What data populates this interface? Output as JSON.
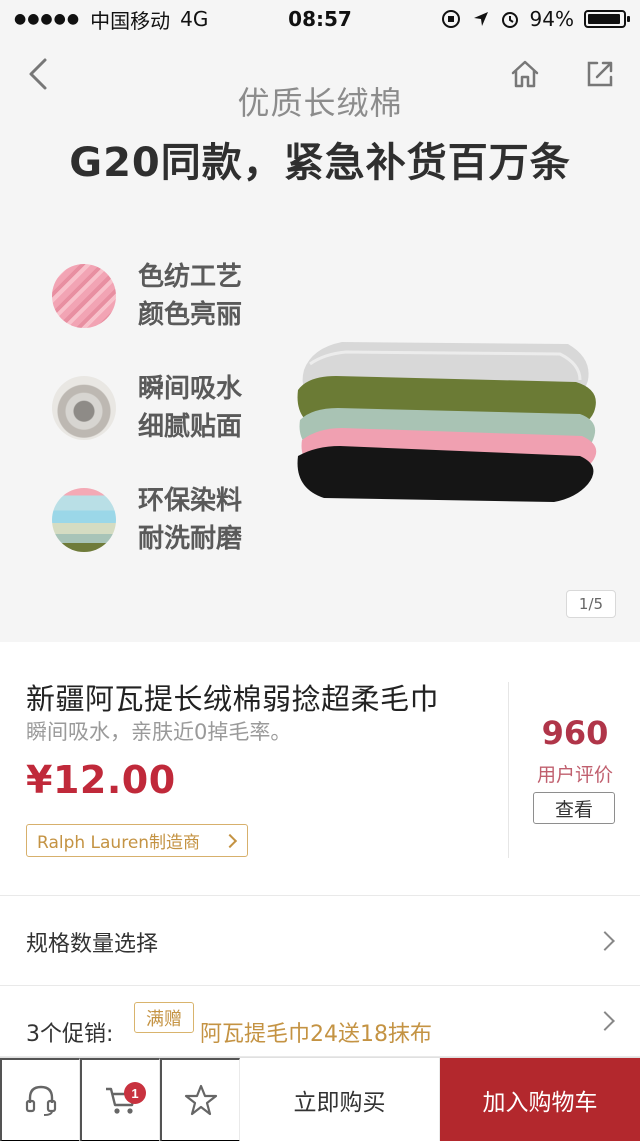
{
  "status_bar": {
    "signal": "●●●●●",
    "carrier": "中国移动",
    "network": "4G",
    "time": "08:57",
    "battery_percent": "94%",
    "battery_level": 0.94
  },
  "nav": {
    "back_icon": "chevron-left-icon",
    "home_icon": "home-icon",
    "share_icon": "share-icon"
  },
  "hero": {
    "subtitle": "优质长绒棉",
    "title": "G20同款，紧急补货百万条",
    "features": [
      {
        "line1": "色纺工艺",
        "line2": "颜色亮丽"
      },
      {
        "line1": "瞬间吸水",
        "line2": "细腻贴面"
      },
      {
        "line1": "环保染料",
        "line2": "耐洗耐磨"
      }
    ],
    "page_indicator": "1/5"
  },
  "product": {
    "title": "新疆阿瓦提长绒棉弱捻超柔毛巾",
    "subtitle": "瞬间吸水，亲肤近0掉毛率。",
    "price": "¥12.00",
    "maker_badge": "Ralph Lauren制造商",
    "review_count": "960",
    "review_label": "用户评价",
    "review_button": "查看"
  },
  "spec": {
    "label": "规格数量选择"
  },
  "promo": {
    "label": "3个促销:",
    "tag": "满赠",
    "text": "阿瓦提毛巾24送18抹布"
  },
  "bottom_bar": {
    "support_icon": "headset-icon",
    "cart_icon": "cart-icon",
    "cart_badge": "1",
    "favorite_icon": "star-icon",
    "buy_now": "立即购买",
    "add_to_cart": "加入购物车"
  },
  "colors": {
    "accent_red": "#b3282d",
    "price_red": "#c0293a",
    "gold": "#c49343"
  }
}
